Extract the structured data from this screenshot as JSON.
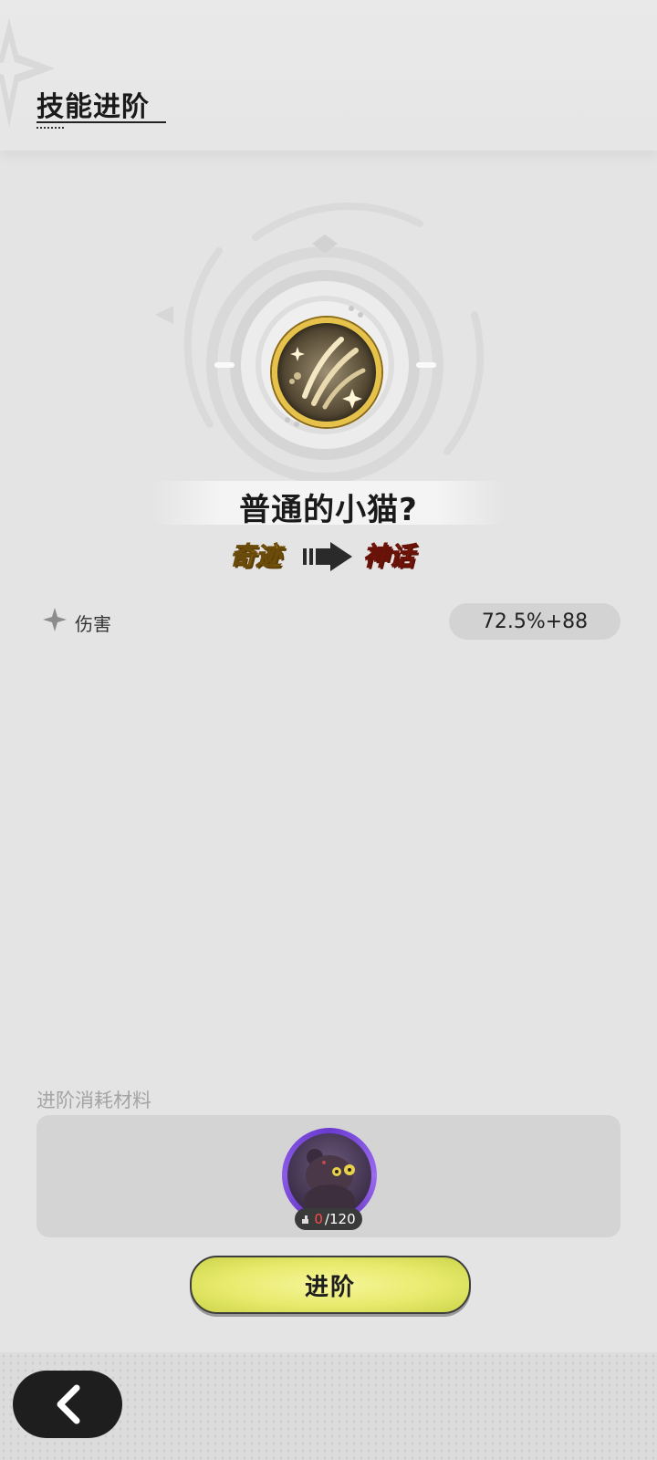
{
  "header": {
    "title": "技能进阶"
  },
  "skill": {
    "name": "普通的小猫?",
    "rank_from": "奇迹",
    "rank_to": "神话",
    "icon": "claw-scratch-icon"
  },
  "stats": [
    {
      "label": "伤害",
      "value": "72.5%+88"
    }
  ],
  "materials": {
    "label": "进阶消耗材料",
    "items": [
      {
        "icon": "shadow-cat-icon",
        "have": "0",
        "need": "/120"
      }
    ]
  },
  "actions": {
    "advance_label": "进阶",
    "back_icon": "chevron-left-icon"
  },
  "colors": {
    "background": "#e4e4e4",
    "rank_from": "#f1c232",
    "rank_to": "#f04a3a",
    "button": "#e7ea6c",
    "material_ring": "#7a4ae0"
  }
}
